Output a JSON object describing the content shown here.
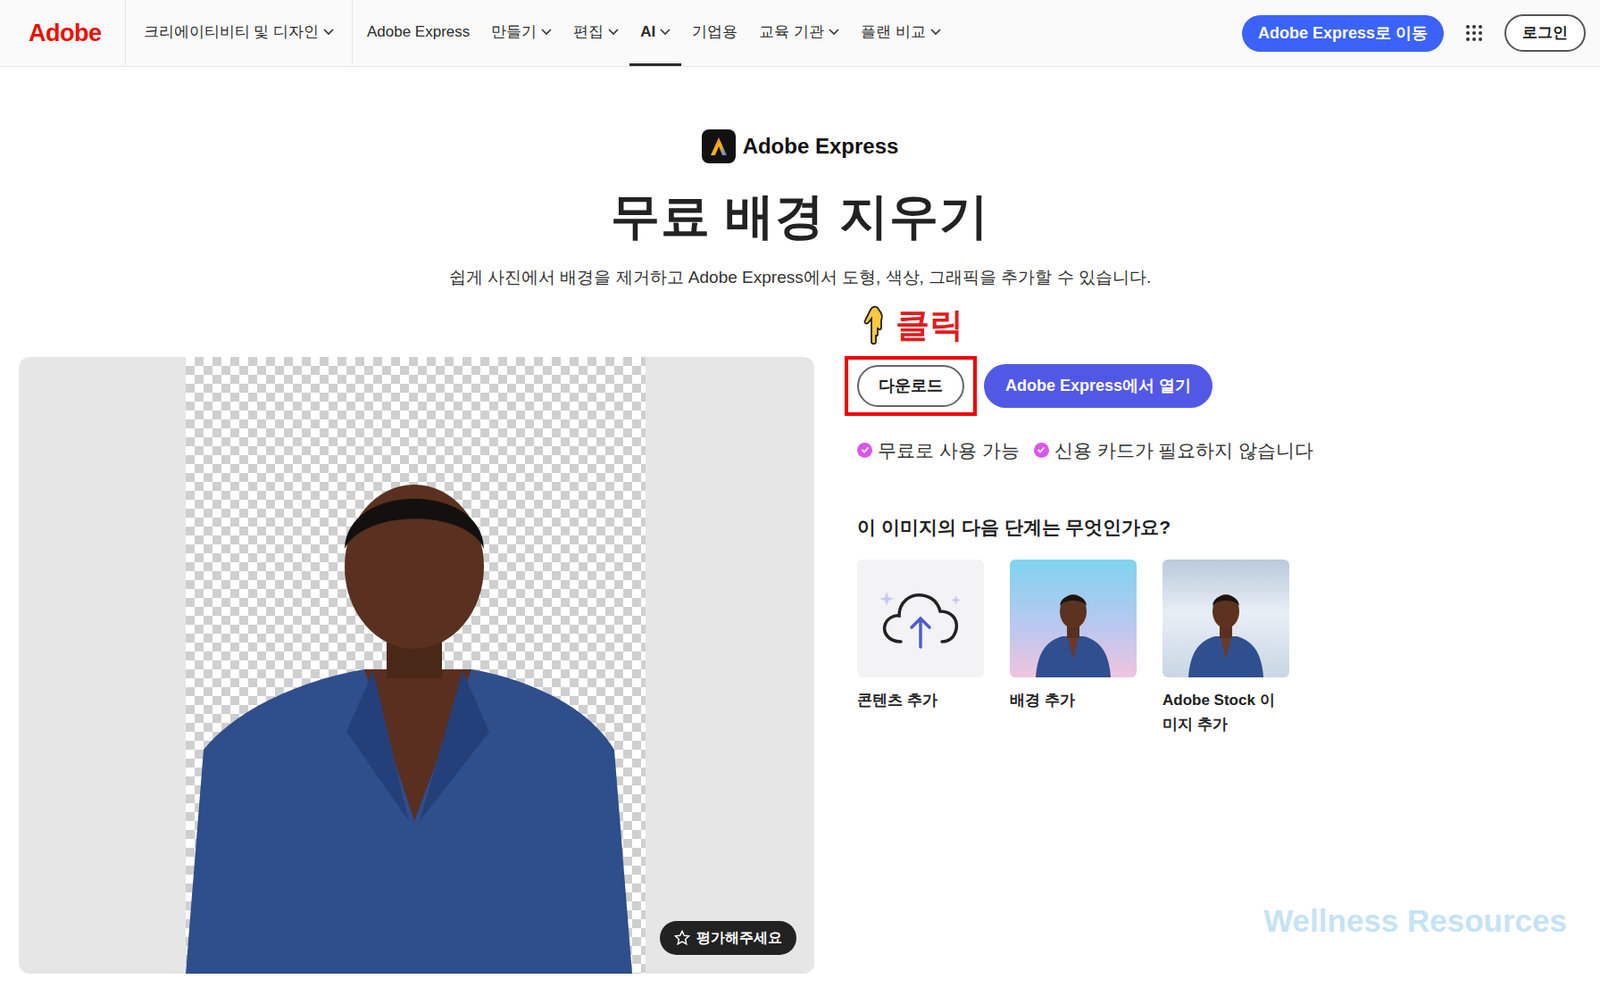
{
  "nav": {
    "logo": "Adobe",
    "items": [
      {
        "label": "크리에이티비티 및 디자인",
        "dropdown": true,
        "selected": false
      },
      {
        "label": "Adobe Express",
        "dropdown": false,
        "selected": false
      },
      {
        "label": "만들기",
        "dropdown": true,
        "selected": false
      },
      {
        "label": "편집",
        "dropdown": true,
        "selected": false
      },
      {
        "label": "AI",
        "dropdown": true,
        "selected": true
      },
      {
        "label": "기업용",
        "dropdown": false,
        "selected": false
      },
      {
        "label": "교육 기관",
        "dropdown": true,
        "selected": false
      },
      {
        "label": "플랜 비교",
        "dropdown": true,
        "selected": false
      }
    ],
    "primary_button": "Adobe Express로 이동",
    "login": "로그인"
  },
  "hero": {
    "brand": "Adobe Express",
    "title": "무료 배경 지우기",
    "subtitle": "쉽게 사진에서 배경을 제거하고 Adobe Express에서 도형, 색상, 그래픽을 추가할 수 있습니다."
  },
  "annotation": {
    "label": "클릭"
  },
  "preview": {
    "rate_button": "평가해주세요"
  },
  "actions": [
    {
      "label": "다운로드",
      "kind": "outline",
      "highlighted": true
    },
    {
      "label": "Adobe Express에서 열기",
      "kind": "primary",
      "highlighted": false
    }
  ],
  "features": [
    "무료로 사용 가능",
    "신용 카드가 필요하지 않습니다"
  ],
  "next_steps": {
    "title": "이 이미지의 다음 단계는 무엇인가요?",
    "items": [
      {
        "label": "콘텐츠 추가",
        "kind": "upload"
      },
      {
        "label": "배경 추가",
        "kind": "gradient"
      },
      {
        "label": "Adobe Stock 이미지 추가",
        "kind": "stock"
      }
    ]
  },
  "watermark": "Wellness Resources"
}
